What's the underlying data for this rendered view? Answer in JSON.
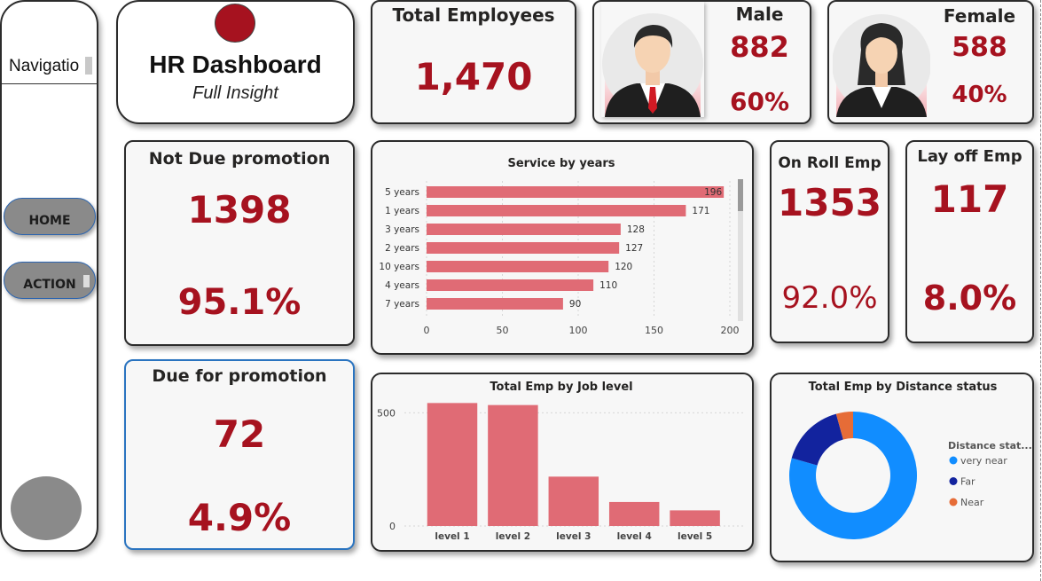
{
  "nav": {
    "title": "Navigatio",
    "buttons": [
      {
        "label": "HOME"
      },
      {
        "label": "ACTION"
      }
    ]
  },
  "header": {
    "title": "HR Dashboard",
    "subtitle": "Full Insight"
  },
  "total_employees": {
    "label": "Total Employees",
    "value": "1,470"
  },
  "male": {
    "label": "Male",
    "count": "882",
    "pct": "60%"
  },
  "female": {
    "label": "Female",
    "count": "588",
    "pct": "40%"
  },
  "not_due": {
    "label": "Not Due promotion",
    "count": "1398",
    "pct": "95.1%"
  },
  "due": {
    "label": "Due for promotion",
    "count": "72",
    "pct": "4.9%"
  },
  "on_roll": {
    "label": "On Roll Emp",
    "count": "1353",
    "pct": "92.0%"
  },
  "lay_off": {
    "label": "Lay off Emp",
    "count": "117",
    "pct": "8.0%"
  },
  "colors": {
    "accent": "#a6121f",
    "bar": "#e06b75",
    "far": "#12239e",
    "very_near": "#118dff",
    "near": "#e66c37"
  },
  "chart_data": [
    {
      "type": "bar",
      "orientation": "horizontal",
      "title": "Service by years",
      "categories": [
        "5 years",
        "1 years",
        "3 years",
        "2 years",
        "10 years",
        "4 years",
        "7 years"
      ],
      "values": [
        196,
        171,
        128,
        127,
        120,
        110,
        90
      ],
      "xlim": [
        0,
        200
      ],
      "xticks": [
        0,
        50,
        100,
        150,
        200
      ],
      "grid": true
    },
    {
      "type": "bar",
      "title": "Total Emp by Job level",
      "categories": [
        "level 1",
        "level 2",
        "level 3",
        "level 4",
        "level 5"
      ],
      "values": [
        543,
        534,
        218,
        106,
        69
      ],
      "ylim": [
        0,
        560
      ],
      "yticks": [
        0,
        500
      ],
      "grid": true
    },
    {
      "type": "pie",
      "donut": true,
      "title": "Total Emp by Distance status",
      "legend_title": "Distance stat...",
      "legend_position": "right",
      "labels": [
        "very near",
        "Far",
        "Near"
      ],
      "values": [
        1167,
        240,
        63
      ]
    }
  ]
}
